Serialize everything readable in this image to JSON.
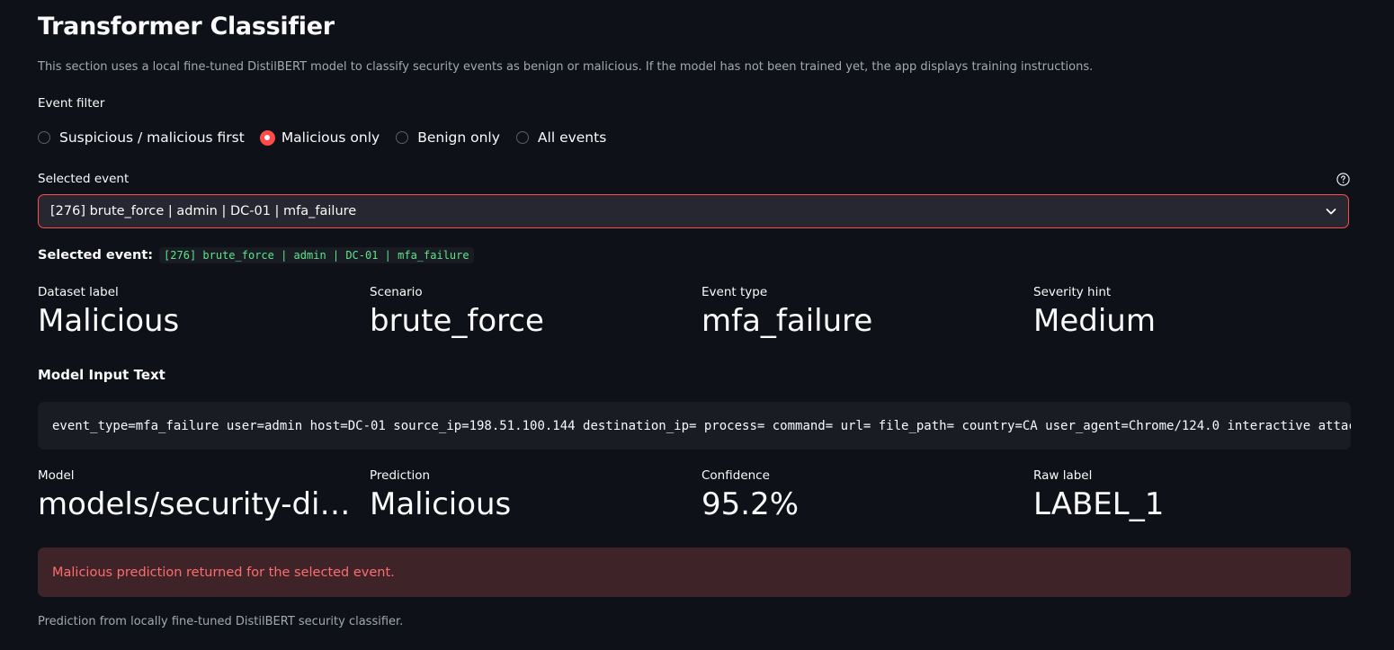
{
  "header": {
    "title": "Transformer Classifier",
    "description": "This section uses a local fine-tuned DistilBERT model to classify security events as benign or malicious. If the model has not been trained yet, the app displays training instructions."
  },
  "filter": {
    "label": "Event filter",
    "options": [
      {
        "label": "Suspicious / malicious first",
        "checked": false
      },
      {
        "label": "Malicious only",
        "checked": true
      },
      {
        "label": "Benign only",
        "checked": false
      },
      {
        "label": "All events",
        "checked": false
      }
    ]
  },
  "select": {
    "label": "Selected event",
    "value": "[276] brute_force | admin | DC-01 | mfa_failure"
  },
  "selected_line": {
    "label": "Selected event:",
    "code": "[276] brute_force | admin | DC-01 | mfa_failure"
  },
  "metrics_top": [
    {
      "label": "Dataset label",
      "value": "Malicious"
    },
    {
      "label": "Scenario",
      "value": "brute_force"
    },
    {
      "label": "Event type",
      "value": "mfa_failure"
    },
    {
      "label": "Severity hint",
      "value": "Medium"
    }
  ],
  "model_input": {
    "heading": "Model Input Text",
    "text": "event_type=mfa_failure user=admin host=DC-01 source_ip=198.51.100.144 destination_ip= process= command= url= file_path= country=CA user_agent=Chrome/124.0 interactive attac"
  },
  "metrics_bottom": [
    {
      "label": "Model",
      "value": "models/security-distilbert"
    },
    {
      "label": "Prediction",
      "value": "Malicious"
    },
    {
      "label": "Confidence",
      "value": "95.2%"
    },
    {
      "label": "Raw label",
      "value": "LABEL_1"
    }
  ],
  "alert": {
    "text": "Malicious prediction returned for the selected event.",
    "color": "#ff6c6c"
  },
  "caption": "Prediction from locally fine-tuned DistilBERT security classifier.",
  "theme": {
    "background": "#0e1117",
    "accent": "#ff4b4b",
    "code_green": "#5ce488"
  }
}
